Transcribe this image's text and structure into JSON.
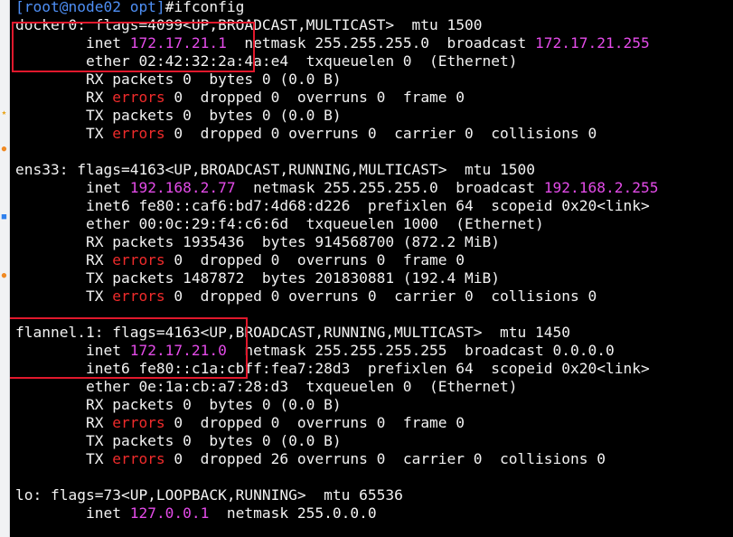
{
  "terminal": {
    "background": "#000000",
    "colors": {
      "text": "#f2f2f2",
      "prompt": "#4e8ff5",
      "address": "#e34be8",
      "error": "#ef2b2b",
      "highlight": "#e0182c"
    },
    "lines": [
      [
        {
          "t": "[root@node02 opt]",
          "c": "prompt"
        },
        {
          "t": "#ifconfig",
          "c": "plain"
        }
      ],
      [
        {
          "t": "docker0: flags=4099<UP,BROADCAST,MULTICAST>  mtu 1500",
          "c": "plain"
        }
      ],
      [
        {
          "t": "        inet ",
          "c": "plain"
        },
        {
          "t": "172.17.21.1",
          "c": "addr"
        },
        {
          "t": "  netmask 255.255.255.0  broadcast ",
          "c": "plain"
        },
        {
          "t": "172.17.21.255",
          "c": "addr"
        }
      ],
      [
        {
          "t": "        ether 02:42:32:2a:4a:e4  txqueuelen 0  (Ethernet)",
          "c": "plain"
        }
      ],
      [
        {
          "t": "        RX packets 0  bytes 0 (0.0 B)",
          "c": "plain"
        }
      ],
      [
        {
          "t": "        RX ",
          "c": "plain"
        },
        {
          "t": "errors",
          "c": "err"
        },
        {
          "t": " 0  dropped 0  overruns 0  frame 0",
          "c": "plain"
        }
      ],
      [
        {
          "t": "        TX packets 0  bytes 0 (0.0 B)",
          "c": "plain"
        }
      ],
      [
        {
          "t": "        TX ",
          "c": "plain"
        },
        {
          "t": "errors",
          "c": "err"
        },
        {
          "t": " 0  dropped 0 overruns 0  carrier 0  collisions 0",
          "c": "plain"
        }
      ],
      [
        {
          "t": "",
          "c": "plain"
        }
      ],
      [
        {
          "t": "ens33: flags=4163<UP,BROADCAST,RUNNING,MULTICAST>  mtu 1500",
          "c": "plain"
        }
      ],
      [
        {
          "t": "        inet ",
          "c": "plain"
        },
        {
          "t": "192.168.2.77",
          "c": "addr"
        },
        {
          "t": "  netmask 255.255.255.0  broadcast ",
          "c": "plain"
        },
        {
          "t": "192.168.2.255",
          "c": "addr"
        }
      ],
      [
        {
          "t": "        inet6 fe80::caf6:bd7:4d68:d226  prefixlen 64  scopeid 0x20<link>",
          "c": "plain"
        }
      ],
      [
        {
          "t": "        ether 00:0c:29:f4:c6:6d  txqueuelen 1000  (Ethernet)",
          "c": "plain"
        }
      ],
      [
        {
          "t": "        RX packets 1935436  bytes 914568700 (872.2 MiB)",
          "c": "plain"
        }
      ],
      [
        {
          "t": "        RX ",
          "c": "plain"
        },
        {
          "t": "errors",
          "c": "err"
        },
        {
          "t": " 0  dropped 0  overruns 0  frame 0",
          "c": "plain"
        }
      ],
      [
        {
          "t": "        TX packets 1487872  bytes 201830881 (192.4 MiB)",
          "c": "plain"
        }
      ],
      [
        {
          "t": "        TX ",
          "c": "plain"
        },
        {
          "t": "errors",
          "c": "err"
        },
        {
          "t": " 0  dropped 0 overruns 0  carrier 0  collisions 0",
          "c": "plain"
        }
      ],
      [
        {
          "t": "",
          "c": "plain"
        }
      ],
      [
        {
          "t": "flannel.1: flags=4163<UP,BROADCAST,RUNNING,MULTICAST>  mtu 1450",
          "c": "plain"
        }
      ],
      [
        {
          "t": "        inet ",
          "c": "plain"
        },
        {
          "t": "172.17.21.0",
          "c": "addr"
        },
        {
          "t": "  netmask 255.255.255.255  broadcast 0.0.0.0",
          "c": "plain"
        }
      ],
      [
        {
          "t": "        inet6 fe80::c1a:cbff:fea7:28d3  prefixlen 64  scopeid 0x20<link>",
          "c": "plain"
        }
      ],
      [
        {
          "t": "        ether 0e:1a:cb:a7:28:d3  txqueuelen 0  (Ethernet)",
          "c": "plain"
        }
      ],
      [
        {
          "t": "        RX packets 0  bytes 0 (0.0 B)",
          "c": "plain"
        }
      ],
      [
        {
          "t": "        RX ",
          "c": "plain"
        },
        {
          "t": "errors",
          "c": "err"
        },
        {
          "t": " 0  dropped 0  overruns 0  frame 0",
          "c": "plain"
        }
      ],
      [
        {
          "t": "        TX packets 0  bytes 0 (0.0 B)",
          "c": "plain"
        }
      ],
      [
        {
          "t": "        TX ",
          "c": "plain"
        },
        {
          "t": "errors",
          "c": "err"
        },
        {
          "t": " 0  dropped 26 overruns 0  carrier 0  collisions 0",
          "c": "plain"
        }
      ],
      [
        {
          "t": "",
          "c": "plain"
        }
      ],
      [
        {
          "t": "lo: flags=73<UP,LOOPBACK,RUNNING>  mtu 65536",
          "c": "plain"
        }
      ],
      [
        {
          "t": "        inet ",
          "c": "plain"
        },
        {
          "t": "127.0.0.1",
          "c": "addr"
        },
        {
          "t": "  netmask 255.0.0.0",
          "c": "plain"
        }
      ]
    ]
  },
  "side_strip": {
    "background": "#f1f2f4",
    "marks": [
      {
        "icon": "star-icon",
        "glyph": "★",
        "color": "#e8a317"
      },
      {
        "icon": "orange-dot-icon",
        "glyph": "●",
        "color": "#f08a24"
      },
      {
        "icon": "blue-square-icon",
        "glyph": "■",
        "color": "#2f80ed"
      }
    ]
  }
}
